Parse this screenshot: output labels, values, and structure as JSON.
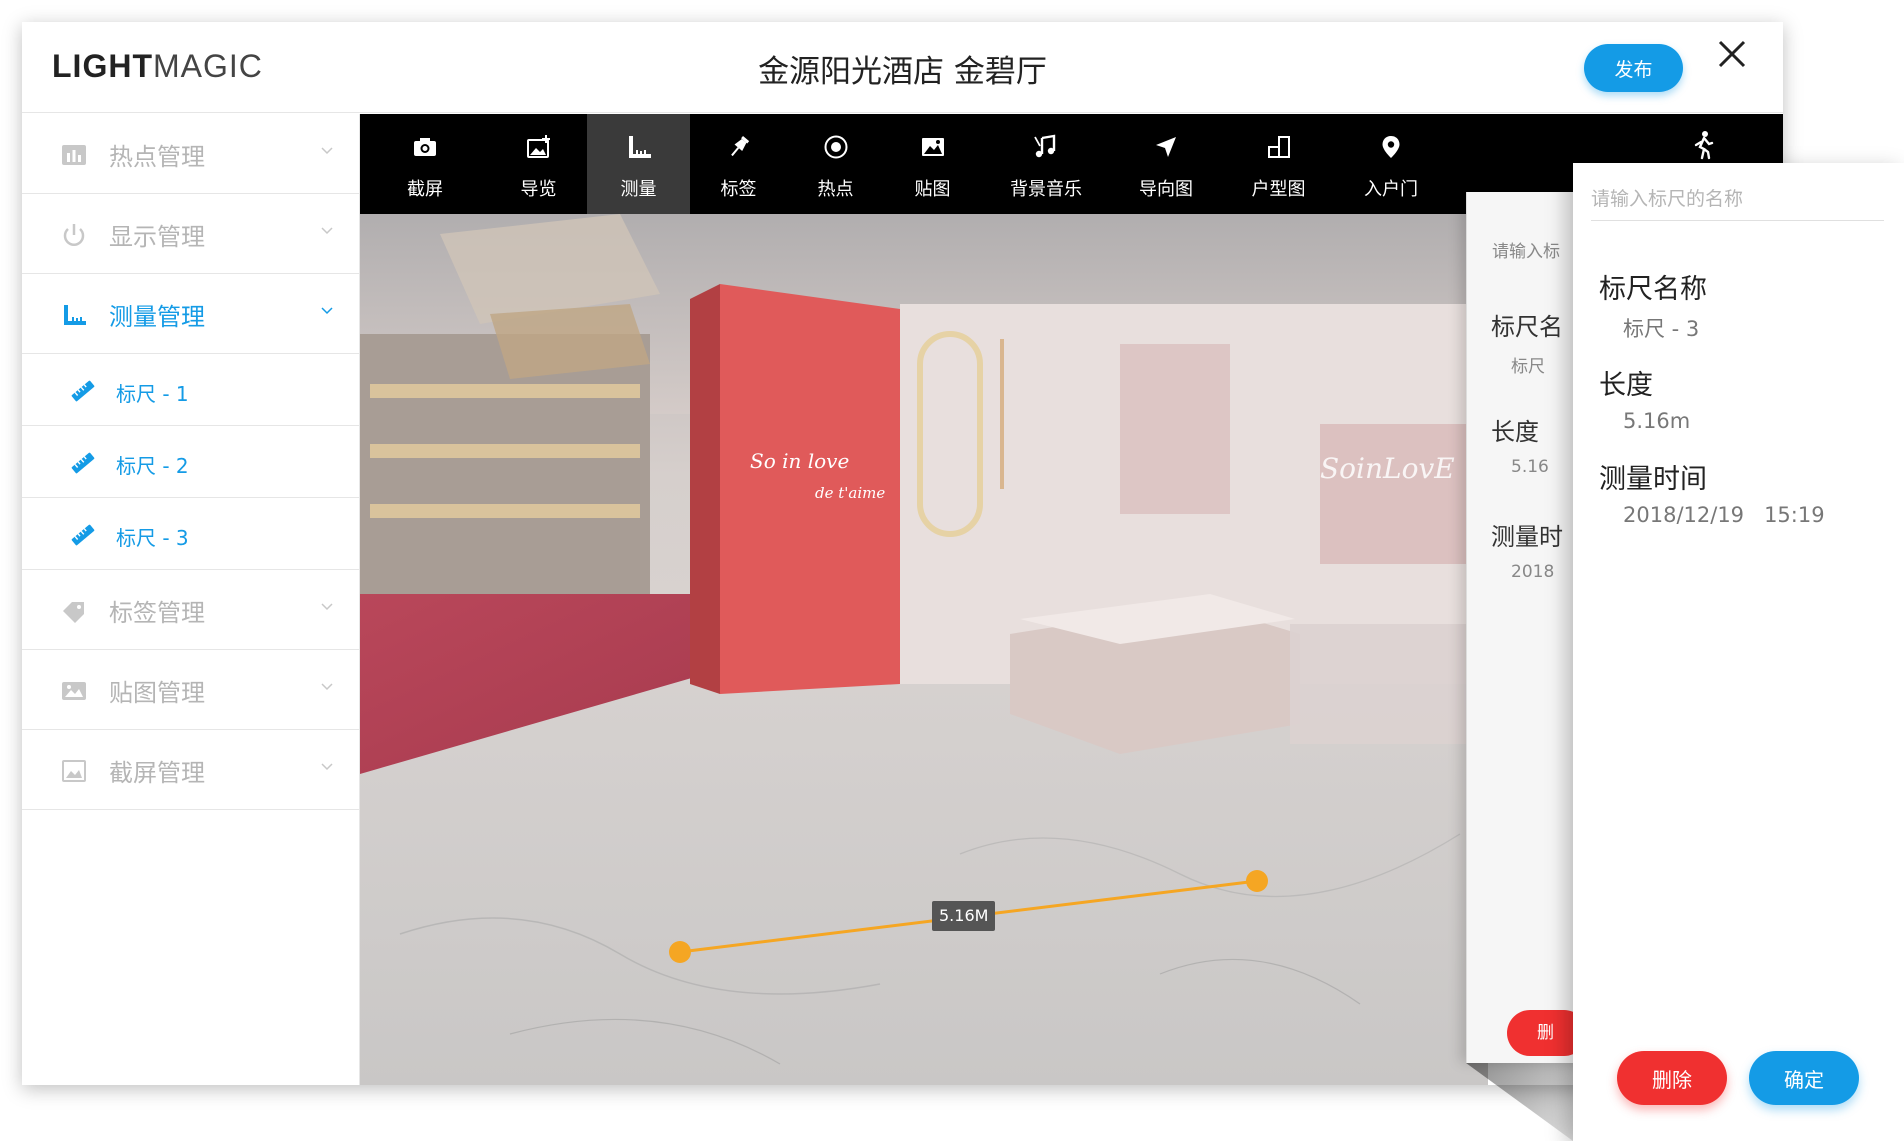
{
  "header": {
    "logo_bold": "LIGHT",
    "logo_thin": "MAGIC",
    "title": "金源阳光酒店 金碧厅",
    "publish_label": "发布",
    "close_icon": "close-icon"
  },
  "sidebar": {
    "items": [
      {
        "label": "热点管理",
        "icon": "bar-chart-icon",
        "active": false
      },
      {
        "label": "显示管理",
        "icon": "power-icon",
        "active": false
      },
      {
        "label": "测量管理",
        "icon": "ruler-corner-icon",
        "active": true
      },
      {
        "label": "标签管理",
        "icon": "tag-icon",
        "active": false
      },
      {
        "label": "贴图管理",
        "icon": "image-icon",
        "active": false
      },
      {
        "label": "截屏管理",
        "icon": "screenshot-icon",
        "active": false
      }
    ],
    "sub_items": [
      {
        "label": "标尺 - 1"
      },
      {
        "label": "标尺 - 2"
      },
      {
        "label": "标尺 - 3"
      }
    ]
  },
  "toolbar": {
    "tools": [
      {
        "label": "截屏",
        "icon": "camera-icon"
      },
      {
        "label": "导览",
        "icon": "image-plus-icon"
      },
      {
        "label": "测量",
        "icon": "ruler-icon",
        "active": true
      },
      {
        "label": "标签",
        "icon": "pin-icon"
      },
      {
        "label": "热点",
        "icon": "target-icon"
      },
      {
        "label": "贴图",
        "icon": "picture-icon"
      },
      {
        "label": "背景音乐",
        "icon": "music-icon"
      },
      {
        "label": "导向图",
        "icon": "navigation-icon"
      },
      {
        "label": "户型图",
        "icon": "floorplan-icon"
      },
      {
        "label": "入户门",
        "icon": "location-pin-icon"
      }
    ],
    "walk_icon": "walking-person-icon"
  },
  "viewport": {
    "measure_label": "5.16M",
    "sign_text_1": "So in love",
    "sign_text_2": "de t'aime",
    "sign_text_3": "SoinLovE",
    "accent_color": "#f5a623"
  },
  "panel_behind": {
    "placeholder": "请输入标",
    "label1": "标尺名",
    "value1": "标尺",
    "label2": "长度",
    "value2": "5.16",
    "label3": "测量时",
    "value3": "2018",
    "delete_label": "删"
  },
  "detail_panel": {
    "name_placeholder": "请输入标尺的名称",
    "name_label": "标尺名称",
    "name_value": "标尺 - 3",
    "length_label": "长度",
    "length_value": "5.16m",
    "time_label": "测量时间",
    "time_value": "2018/12/19   15:19",
    "delete_label": "删除",
    "confirm_label": "确定"
  },
  "colors": {
    "primary": "#149be6",
    "danger": "#f03030",
    "toolbar_bg": "#000000",
    "muted_text": "#b5b5b5"
  }
}
